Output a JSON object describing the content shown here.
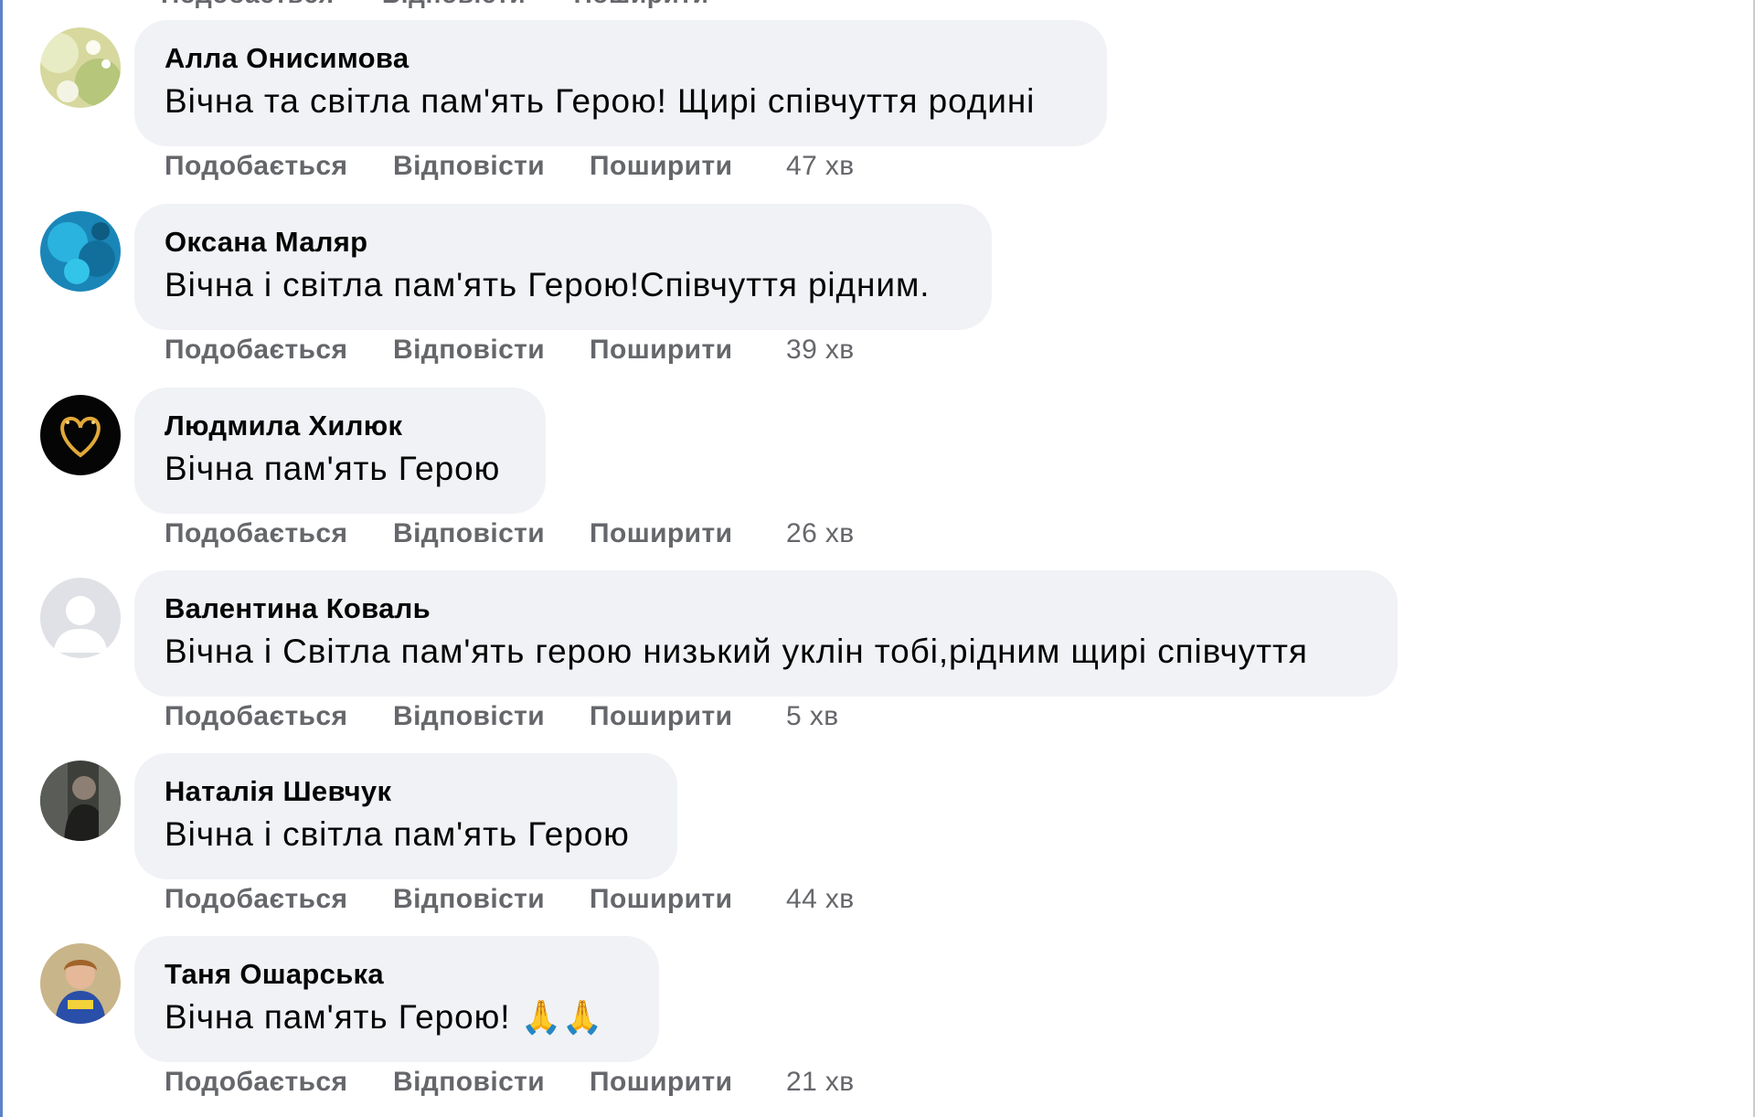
{
  "top_cut_actions": [
    "Подобається",
    "Відповісти",
    "Поширити"
  ],
  "action_labels": {
    "like": "Подобається",
    "reply": "Відповісти",
    "share": "Поширити"
  },
  "comments": [
    {
      "author": "Алла Онисимова",
      "text": "Вічна та світла пам'ять Герою! Щирі співчуття родині",
      "time": "47 хв",
      "avatar": "flowers-photo-avatar"
    },
    {
      "author": "Оксана Маляр",
      "text": "Вічна і світла пам'ять Герою!Співчуття рідним.",
      "time": "39 хв",
      "avatar": "blue-flowers-avatar"
    },
    {
      "author": "Людмила Хилюк",
      "text": "Вічна пам'ять Герою",
      "time": "26 хв",
      "avatar": "golden-heart-avatar"
    },
    {
      "author": "Валентина Коваль",
      "text": "Вічна і Світла пам'ять герою низький уклін тобі,рідним щирі співчуття",
      "time": "5 хв",
      "avatar": "default-profile-avatar"
    },
    {
      "author": "Наталія Шевчук",
      "text": "Вічна і світла пам'ять Герою",
      "time": "44 хв",
      "avatar": "person-photo-avatar"
    },
    {
      "author": "Таня Ошарська",
      "text": "Вічна пам'ять Герою!",
      "emoji": "🙏🙏",
      "time": "21 хв",
      "avatar": "woman-photo-avatar"
    }
  ],
  "colors": {
    "bubble": "#f0f2f5",
    "name": "#050505",
    "meta": "#65676b",
    "window_border": "#5b83c8"
  }
}
